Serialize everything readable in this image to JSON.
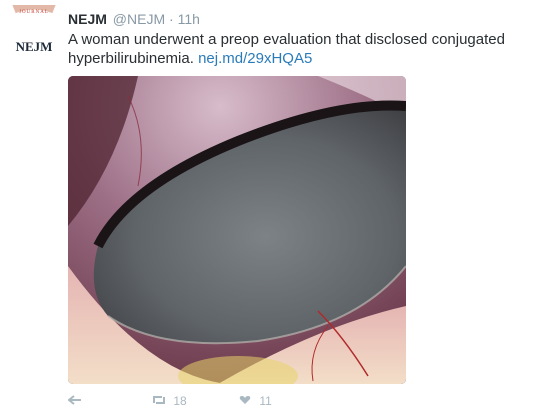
{
  "tweet": {
    "avatar_text": "NEJM",
    "avatar_arc_text": "JOURNAL",
    "author_name": "NEJM",
    "author_handle": "@NEJM",
    "separator": "·",
    "time": "11h",
    "text_before_link": "A woman underwent a preop evaluation that disclosed conjugated hyperbilirubinemia.",
    "link_text": "nej.md/29xHQA5"
  },
  "actions": {
    "reply_icon": "reply-icon",
    "retweet_icon": "retweet-icon",
    "retweet_count": "18",
    "like_icon": "heart-icon",
    "like_count": "11"
  },
  "colors": {
    "name": "#292f33",
    "meta": "#8899a6",
    "link": "#2b7bb9",
    "avatar_red": "#c9372c"
  }
}
